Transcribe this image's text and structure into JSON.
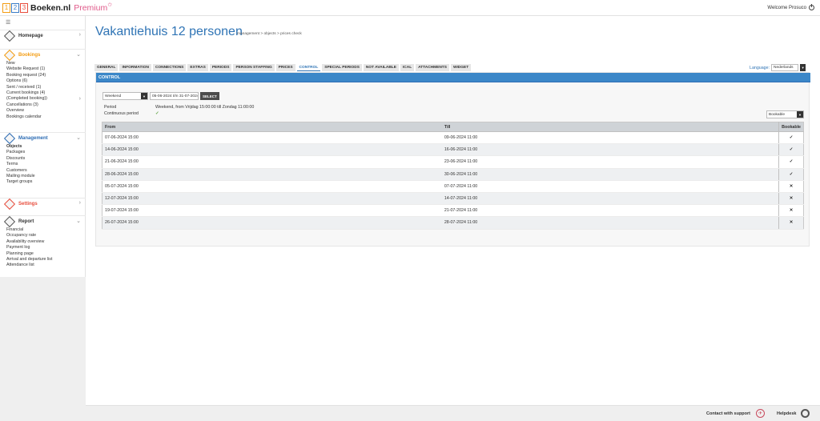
{
  "app": {
    "logo": {
      "d1": "1",
      "d2": "2",
      "d3": "3",
      "brand": "Boeken.nl",
      "premium": "Premium",
      "star": "✩"
    },
    "welcome": "Welcome Prosuco"
  },
  "sidebar": {
    "homepage": "Homepage",
    "bookings": {
      "title": "Bookings",
      "items": [
        "New",
        "Website Request (1)",
        "Booking request (24)",
        "Options (6)",
        "Sent / received (1)",
        "Current bookings (4)",
        "(Completed booking))",
        "Cancellations (3)",
        "Overview",
        "Bookings calendar"
      ]
    },
    "management": {
      "title": "Management",
      "items": [
        "Objects",
        "Packages",
        "Discounts",
        "Terms",
        "Customers",
        "Mailing module",
        "Target groups"
      ]
    },
    "settings": "Settings",
    "report": {
      "title": "Report",
      "items": [
        "Financial",
        "Occupancy rate",
        "Availability overview",
        "Payment log",
        "Planning page",
        "Arrival and departure list",
        "Attendance list"
      ]
    }
  },
  "page": {
    "title": "Vakantiehuis 12 personen",
    "breadcrumb": "management > objects > prices check"
  },
  "tabs": [
    "GENERAL",
    "INFORMATION",
    "CONNECTIONS",
    "EXTRAS",
    "PERIODS",
    "PERSON STAFFING",
    "PRICES",
    "CONTROL",
    "SPECIAL PERIODS",
    "NOT AVAILABLE",
    "ICAL",
    "ATTACHMENTS",
    "WIDGET"
  ],
  "active_tab": "CONTROL",
  "language": {
    "label": "Language:",
    "value": "Nederlands"
  },
  "control": {
    "header": "CONTROL",
    "period_select": "Weekend",
    "date_range": "05-06-2024 t/m 31-07-2024",
    "select_button": "SELECT",
    "period_label": "Period",
    "period_value": "Weekend, from Vrijdag 15:00:00 till Zondag 11:00:00",
    "continuous_label": "Continuous period",
    "continuous_value": "✓",
    "filter": "Bookable",
    "table": {
      "headers": {
        "from": "From",
        "till": "Till",
        "bookable": "Bookable"
      },
      "rows": [
        {
          "from": "07-06-2024 15:00",
          "till": "09-06-2024 11:00",
          "bookable": "✓"
        },
        {
          "from": "14-06-2024 15:00",
          "till": "16-06-2024 11:00",
          "bookable": "✓"
        },
        {
          "from": "21-06-2024 15:00",
          "till": "23-06-2024 11:00",
          "bookable": "✓"
        },
        {
          "from": "28-06-2024 15:00",
          "till": "30-06-2024 11:00",
          "bookable": "✓"
        },
        {
          "from": "05-07-2024 15:00",
          "till": "07-07-2024 11:00",
          "bookable": "✕"
        },
        {
          "from": "12-07-2024 15:00",
          "till": "14-07-2024 11:00",
          "bookable": "✕"
        },
        {
          "from": "19-07-2024 15:00",
          "till": "21-07-2024 11:00",
          "bookable": "✕"
        },
        {
          "from": "26-07-2024 15:00",
          "till": "28-07-2024 11:00",
          "bookable": "✕"
        }
      ]
    }
  },
  "footer": {
    "contact": "Contact with support",
    "helpdesk": "Helpdesk"
  },
  "colors": {
    "accent": "#2f74b5",
    "header_bar": "#3b87c8",
    "ok": "#6aa84f",
    "no": "#d0021b",
    "bookings": "#f39c12",
    "settings": "#e74c3c"
  }
}
